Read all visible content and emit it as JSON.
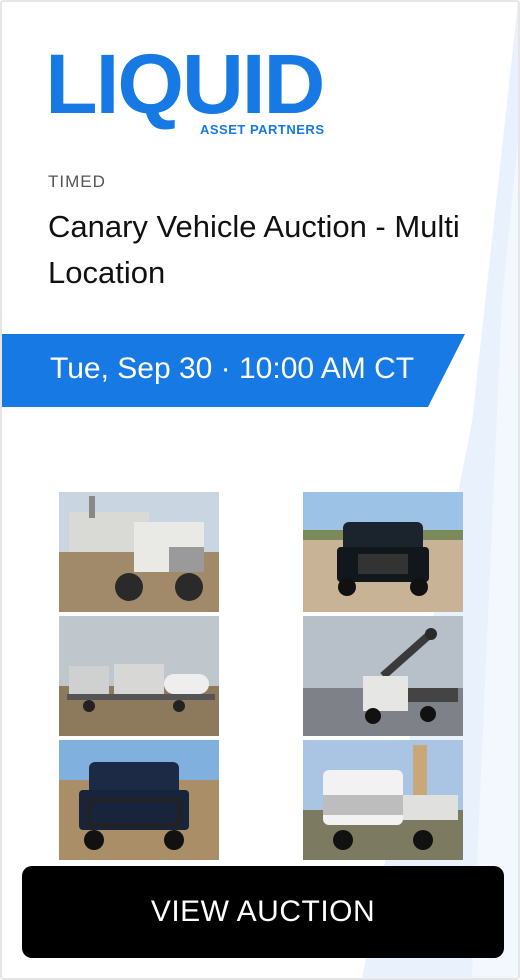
{
  "brand": {
    "name": "LIQUID",
    "tagline": "ASSET PARTNERS",
    "color": "#1779e3"
  },
  "auction": {
    "type": "TIMED",
    "title": "Canary Vehicle Auction - Multi Location",
    "date": "Tue, Sep 30 · 10:00 AM CT"
  },
  "gallery": [
    {
      "icon": "vacuum-truck-photo"
    },
    {
      "icon": "black-pickup-front-photo"
    },
    {
      "icon": "flatbed-trailer-tanks-photo"
    },
    {
      "icon": "boom-truck-photo"
    },
    {
      "icon": "blue-pickup-grille-guard-photo"
    },
    {
      "icon": "white-crane-truck-photo"
    }
  ],
  "cta": {
    "label": "VIEW AUCTION"
  }
}
